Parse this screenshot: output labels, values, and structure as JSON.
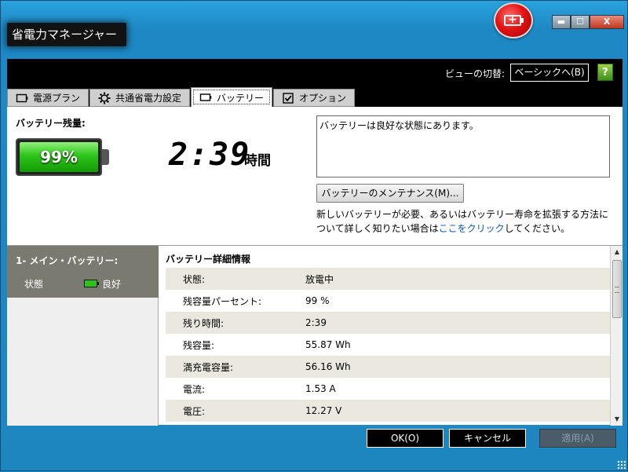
{
  "window": {
    "title": "省電力マネージャー",
    "controls": {
      "minimize": "▬",
      "maximize": "☐",
      "close": "X"
    }
  },
  "view": {
    "label": "ビューの切替:",
    "switch_button": "ベーシックへ(B)",
    "help_icon": "?"
  },
  "tabs": [
    {
      "label": "電源プラン",
      "icon": "battery-outline-icon"
    },
    {
      "label": "共通省電力設定",
      "icon": "gear-icon"
    },
    {
      "label": "バッテリー",
      "icon": "battery-outline-icon",
      "active": true
    },
    {
      "label": "オプション",
      "icon": "checkbox-icon"
    }
  ],
  "battery": {
    "remaining_label": "バッテリー残量:",
    "percent_text": "99%",
    "time_digits": "2:39",
    "time_unit": "時間",
    "status_message": "バッテリーは良好な状態にあります。",
    "maintenance_button": "バッテリーのメンテナンス(M)...",
    "info_text_before": "新しいバッテリーが必要、あるいはバッテリー寿命を拡張する方法について詳しく知りたい場合は",
    "info_link": "ここをクリック",
    "info_text_after": "してください。"
  },
  "sidebar": {
    "title": "1- メイン・バッテリー:",
    "state_label": "状態",
    "state_value": "良好"
  },
  "details": {
    "title": "バッテリー詳細情報",
    "rows": [
      {
        "key": "状態:",
        "value": "放電中"
      },
      {
        "key": "残容量パーセント:",
        "value": "99 %"
      },
      {
        "key": "残り時間:",
        "value": "2:39"
      },
      {
        "key": "残容量:",
        "value": "55.87 Wh"
      },
      {
        "key": "満充電容量:",
        "value": "56.16 Wh"
      },
      {
        "key": "電流:",
        "value": "1.53 A"
      },
      {
        "key": "電圧:",
        "value": "12.27 V"
      }
    ]
  },
  "footer": {
    "ok": "OK(O)",
    "cancel": "キャンセル",
    "apply": "適用(A)"
  },
  "colors": {
    "window_bg": "#1e86bf",
    "battery_green": "#2dc41a",
    "side_header": "#7b7a70",
    "link": "#0a58b8"
  }
}
